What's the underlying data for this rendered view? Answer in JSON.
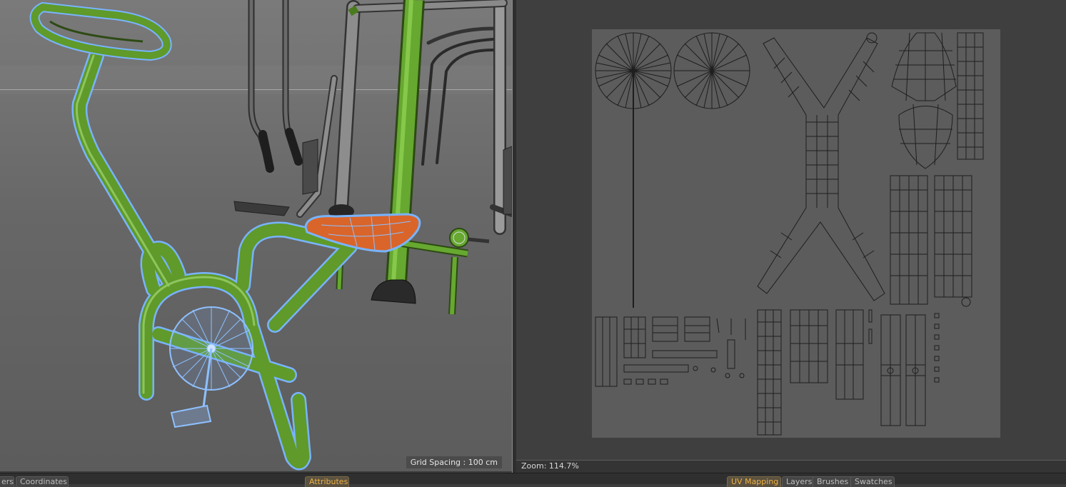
{
  "viewport": {
    "grid_spacing_label": "Grid Spacing : 100 cm"
  },
  "uv_editor": {
    "zoom_label": "Zoom: 114.7%"
  },
  "bottom_tabs": {
    "left": [
      {
        "label": "ers"
      },
      {
        "label": "Coordinates"
      }
    ],
    "center": {
      "label": "Attributes"
    },
    "right": [
      {
        "label": "UV Mapping"
      },
      {
        "label": "Layers"
      },
      {
        "label": "Brushes"
      },
      {
        "label": "Swatches"
      }
    ]
  },
  "colors": {
    "frame_green": "#5f9a2a",
    "selection_blue": "#78b4ff",
    "seat_orange": "#d9652a",
    "active_tab": "#f0b040"
  }
}
